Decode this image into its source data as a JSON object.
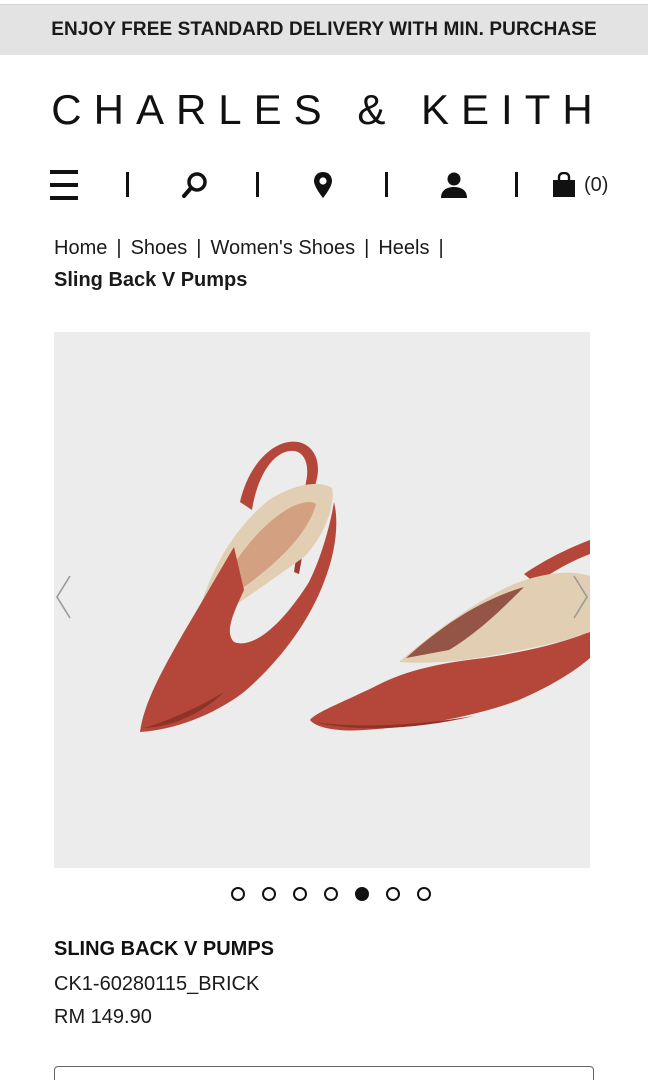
{
  "promo": {
    "text": "ENJOY FREE STANDARD DELIVERY WITH MIN. PURCHASE"
  },
  "brand": {
    "name": "CHARLES & KEITH"
  },
  "nav": {
    "icons": [
      "menu-icon",
      "search-icon",
      "location-pin-icon",
      "user-icon",
      "shopping-bag-icon"
    ],
    "cart_count": "(0)"
  },
  "breadcrumb": {
    "items": [
      "Home",
      "Shoes",
      "Women's Shoes",
      "Heels"
    ],
    "separator": "|",
    "current": "Sling Back V Pumps"
  },
  "gallery": {
    "image_alt": "brick sling back v pumps",
    "dots_total": 7,
    "active_index": 4,
    "colors": {
      "background": "#ececec",
      "shoe": "#b5473a",
      "lining": "#e2cfb3"
    }
  },
  "product": {
    "title": "SLING BACK V PUMPS",
    "sku": "CK1-60280115_BRICK",
    "price": "RM 149.90"
  }
}
